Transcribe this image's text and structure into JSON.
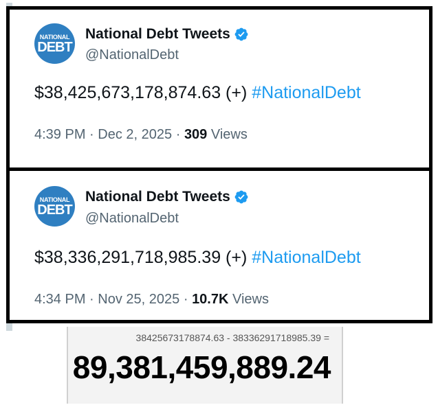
{
  "tweets": [
    {
      "avatar": {
        "line1": "NATIONAL",
        "line2": "DEBT"
      },
      "display_name": "National Debt Tweets",
      "handle": "@NationalDebt",
      "amount": "$38,425,673,178,874.63 (+)",
      "hashtag": "#NationalDebt",
      "time": "4:39 PM",
      "date": "Dec 2, 2025",
      "views_count": "309",
      "views_label": "Views"
    },
    {
      "avatar": {
        "line1": "NATIONAL",
        "line2": "DEBT"
      },
      "display_name": "National Debt Tweets",
      "handle": "@NationalDebt",
      "amount": "$38,336,291,718,985.39 (+)",
      "hashtag": "#NationalDebt",
      "time": "4:34 PM",
      "date": "Nov 25, 2025",
      "views_count": "10.7K",
      "views_label": "Views"
    }
  ],
  "calculator": {
    "expression": "38425673178874.63 - 38336291718985.39 =",
    "result": "89,381,459,889.24"
  },
  "colors": {
    "accent": "#1d9bf0",
    "verified": "#1d9bf0",
    "avatar_bg": "#2f7fc1",
    "text": "#0f1419",
    "muted": "#536471"
  },
  "icons": {
    "verified": "verified-badge-icon"
  }
}
